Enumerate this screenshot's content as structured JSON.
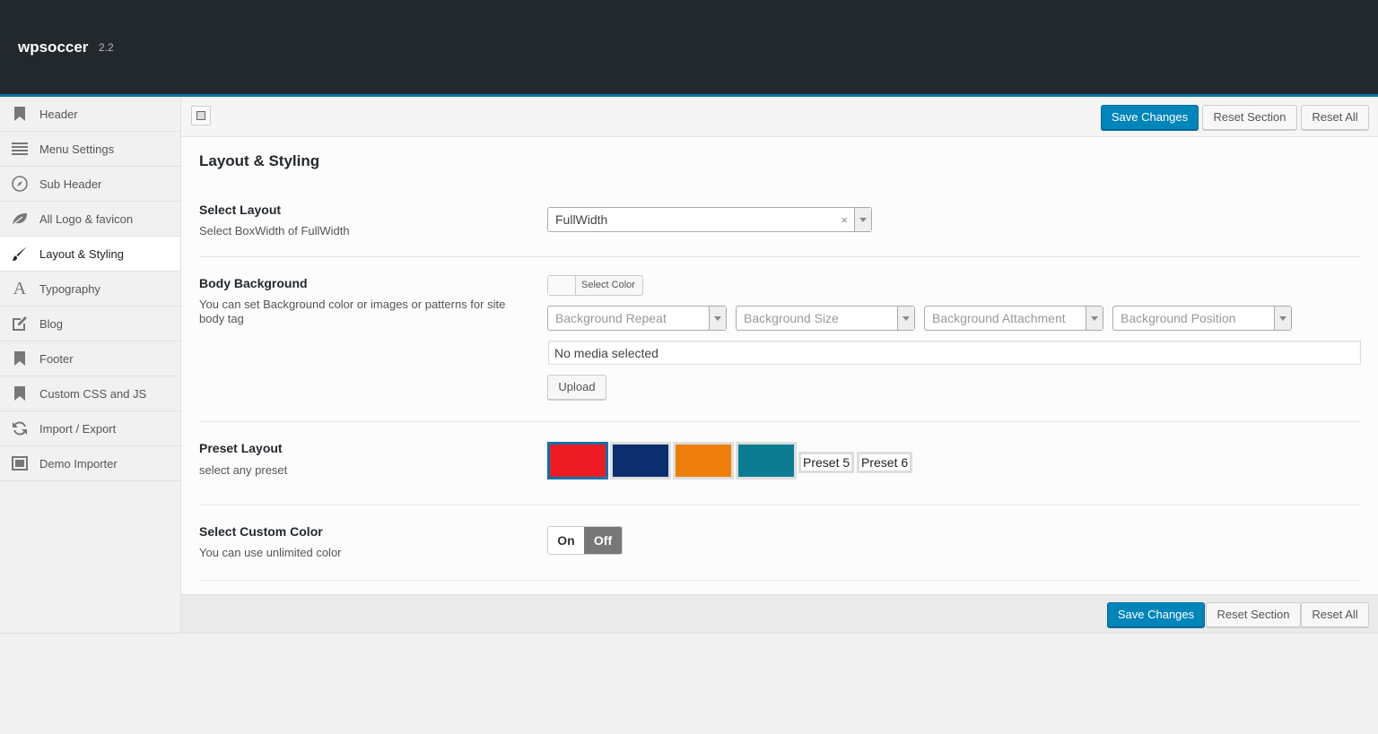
{
  "header": {
    "brand": "wpsoccer",
    "version": "2.2"
  },
  "sidebar": {
    "items": [
      {
        "label": "Header",
        "icon": "bookmark-icon"
      },
      {
        "label": "Menu Settings",
        "icon": "menu-lines-icon"
      },
      {
        "label": "Sub Header",
        "icon": "compass-icon"
      },
      {
        "label": "All Logo & favicon",
        "icon": "leaf-icon"
      },
      {
        "label": "Layout & Styling",
        "icon": "brush-icon",
        "active": true
      },
      {
        "label": "Typography",
        "icon": "font-icon"
      },
      {
        "label": "Blog",
        "icon": "edit-icon"
      },
      {
        "label": "Footer",
        "icon": "bookmark-icon"
      },
      {
        "label": "Custom CSS and JS",
        "icon": "bookmark-icon"
      },
      {
        "label": "Import / Export",
        "icon": "refresh-icon"
      },
      {
        "label": "Demo Importer",
        "icon": "window-icon"
      }
    ]
  },
  "toolbar": {
    "save_label": "Save Changes",
    "reset_section_label": "Reset Section",
    "reset_all_label": "Reset All"
  },
  "section": {
    "title": "Layout & Styling",
    "select_layout": {
      "title": "Select Layout",
      "desc": "Select BoxWidth of FullWidth",
      "value": "FullWidth",
      "clear": "×"
    },
    "body_background": {
      "title": "Body Background",
      "desc": "You can set Background color or images or patterns for site body tag",
      "color_label": "Select Color",
      "repeat_placeholder": "Background Repeat",
      "size_placeholder": "Background Size",
      "attachment_placeholder": "Background Attachment",
      "position_placeholder": "Background Position",
      "media_text": "No media selected",
      "upload_label": "Upload"
    },
    "preset_layout": {
      "title": "Preset Layout",
      "desc": "select any preset",
      "colors": [
        "#ed1c24",
        "#0c2e6e",
        "#ee7e0b",
        "#0b7c91"
      ],
      "text_presets": [
        "Preset 5",
        "Preset 6"
      ]
    },
    "custom_color": {
      "title": "Select Custom Color",
      "desc": "You can use unlimited color",
      "on_label": "On",
      "off_label": "Off"
    }
  },
  "colors": {
    "accent": "#0085ba",
    "topbar": "#23282d"
  }
}
